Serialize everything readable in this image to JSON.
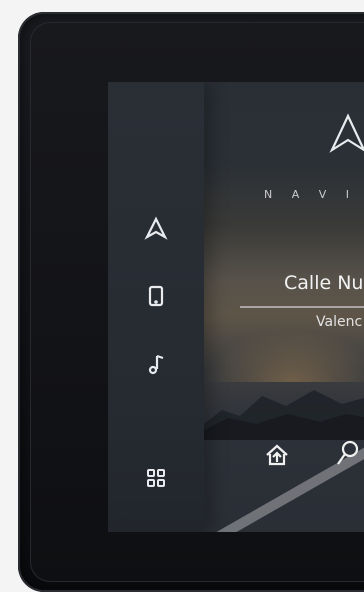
{
  "sidebar": {
    "items": [
      {
        "icon": "navigation-arrow-icon"
      },
      {
        "icon": "phone-icon"
      },
      {
        "icon": "music-note-icon"
      },
      {
        "icon": "grid-apps-icon"
      }
    ]
  },
  "main": {
    "title": "N A V I G A",
    "street": "Calle Nu",
    "city": "Valenc",
    "actions": [
      {
        "icon": "home-icon"
      },
      {
        "icon": "search-icon"
      }
    ]
  },
  "colors": {
    "screen_bg": "#2a2f36",
    "text": "#f2f2f2",
    "dusk_glow": "#d2a05a"
  }
}
